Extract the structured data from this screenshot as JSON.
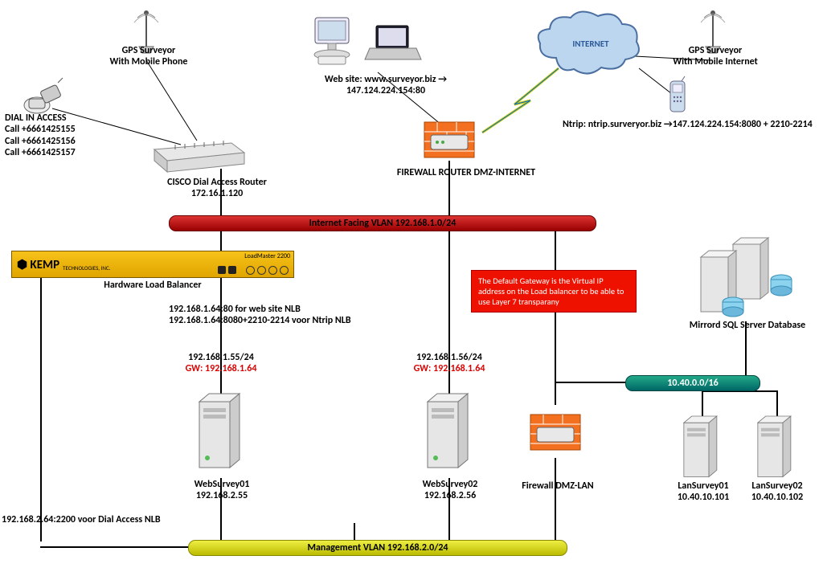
{
  "gps_mobile": {
    "title": "GPS Surveyor",
    "sub": "With Mobile Phone"
  },
  "dial_in": {
    "title": "DIAL IN ACCESS",
    "l1": "Call +6661425155",
    "l2": "Call +6661425156",
    "l3": "Call +6661425157"
  },
  "website": {
    "l1": "Web site: www.surveyor.biz →",
    "l2": "147.124.224.154:80"
  },
  "internet": "INTERNET",
  "gps_internet": {
    "title": "GPS Surveyor",
    "sub": "With Mobile Internet"
  },
  "ntrip": "Ntrip: ntrip.surveryor.biz →147.124.224.154:8080 + 2210-2214",
  "cisco": {
    "name": "CISCO Dial Access Router",
    "ip": "172.16.1.120"
  },
  "fw_dmz_inet": "FIREWALL ROUTER DMZ-INTERNET",
  "vlan_internet": "Internet Facing VLAN 192.168.1.0/24",
  "kemp": {
    "brand": "KEMP",
    "tag": "TECHNOLOGIES, INC.",
    "model": "LoadMaster 2200",
    "label": "Hardware Load Balancer"
  },
  "nlb": {
    "l1": "192.168.1.64:80 for web site NLB",
    "l2": "192.168.1.64:8080+2210-2214 voor Ntrip NLB"
  },
  "note_gw": "The Default Gateway is the Virtual IP address on the Load balancer to be able to use Layer 7 transparany",
  "sql": "Mirrord SQL Server Database",
  "ws1": {
    "ip": "192.168.1.55/24",
    "gw": "GW: 192.168.1.64",
    "name": "WebSurvey01",
    "ip2": "192.168.2.55"
  },
  "ws2": {
    "ip": "192.168.1.56/24",
    "gw": "GW: 192.168.1.64",
    "name": "WebSurvey02",
    "ip2": "192.168.2.56"
  },
  "vlan_db": "10.40.0.0/16",
  "fw_dmz_lan": "Firewall DMZ-LAN",
  "ls1": {
    "name": "LanSurvey01",
    "ip": "10.40.10.101"
  },
  "ls2": {
    "name": "LanSurvey02",
    "ip": "10.40.10.102"
  },
  "dial_nlb": "192.168.2.64:2200 voor Dial Access NLB",
  "vlan_mgmt": "Management VLAN 192.168.2.0/24"
}
